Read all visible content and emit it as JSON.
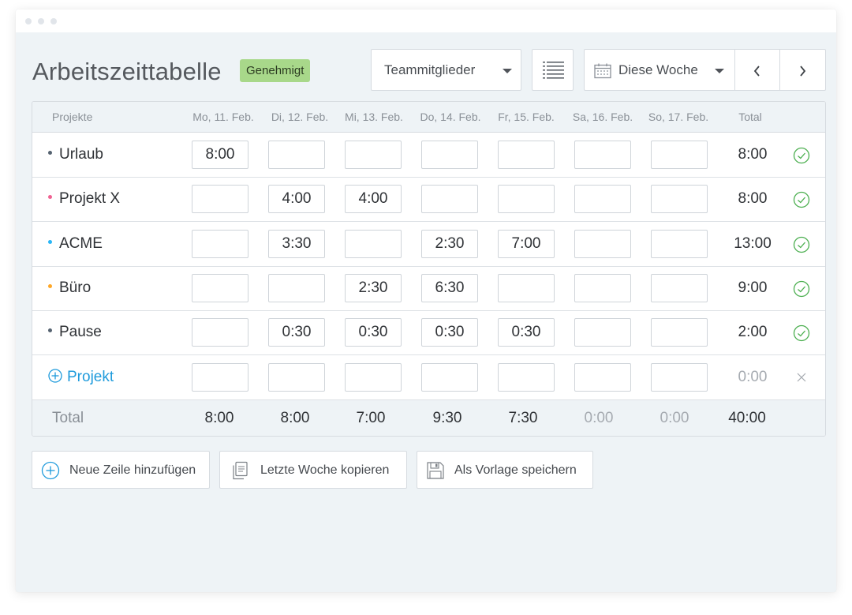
{
  "header": {
    "title": "Arbeitszeittabelle",
    "status": "Genehmigt",
    "team_select": "Teammitglieder",
    "week_select": "Diese Woche"
  },
  "table": {
    "columns": [
      "Projekte",
      "Mo, 11. Feb.",
      "Di, 12. Feb.",
      "Mi, 13. Feb.",
      "Do, 14. Feb.",
      "Fr, 15. Feb.",
      "Sa, 16. Feb.",
      "So, 17. Feb.",
      "Total"
    ],
    "rows": [
      {
        "name": "Urlaub",
        "dot_color": "#556270",
        "cells": [
          "8:00",
          "",
          "",
          "",
          "",
          "",
          ""
        ],
        "total": "8:00"
      },
      {
        "name": "Projekt X",
        "dot_color": "#f06292",
        "cells": [
          "",
          "4:00",
          "4:00",
          "",
          "",
          "",
          ""
        ],
        "total": "8:00"
      },
      {
        "name": "ACME",
        "dot_color": "#29b6f6",
        "cells": [
          "",
          "3:30",
          "",
          "2:30",
          "7:00",
          "",
          ""
        ],
        "total": "13:00"
      },
      {
        "name": "Büro",
        "dot_color": "#ffa726",
        "cells": [
          "",
          "",
          "2:30",
          "6:30",
          "",
          "",
          ""
        ],
        "total": "9:00"
      },
      {
        "name": "Pause",
        "dot_color": "#556270",
        "cells": [
          "",
          "0:30",
          "0:30",
          "0:30",
          "0:30",
          "",
          ""
        ],
        "total": "2:00"
      }
    ],
    "add_row": {
      "label": "Projekt",
      "total": "0:00"
    },
    "footer": {
      "label": "Total",
      "values": [
        "8:00",
        "8:00",
        "7:00",
        "9:30",
        "7:30",
        "0:00",
        "0:00"
      ],
      "total": "40:00"
    }
  },
  "actions": {
    "add_row": "Neue Zeile hinzufügen",
    "copy_last_week": "Letzte Woche kopieren",
    "save_template": "Als Vorlage speichern"
  },
  "colors": {
    "accent": "#1f9bdc",
    "approved_badge": "#a8d88a",
    "check": "#4caf50"
  }
}
